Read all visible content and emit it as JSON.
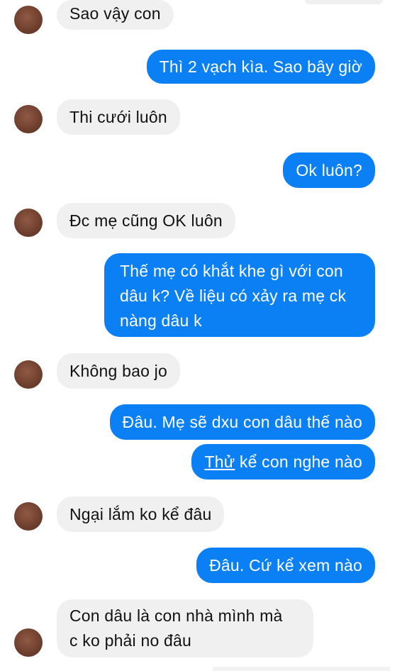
{
  "messages": [
    {
      "side": "in",
      "text": "Sao vậy con"
    },
    {
      "side": "out",
      "text": "Thì 2 vạch kìa. Sao bây giờ"
    },
    {
      "side": "in",
      "text": "Thi cưới luôn"
    },
    {
      "side": "out",
      "text": "Ok luôn?"
    },
    {
      "side": "in",
      "text": "Đc mẹ cũng OK luôn"
    },
    {
      "side": "out",
      "lines": [
        "Thế mẹ có khắt khe gì với con",
        "dâu k? Về liệu có xảy ra mẹ ck",
        "nàng dâu k"
      ]
    },
    {
      "side": "in",
      "text": "Không bao jo"
    },
    {
      "side": "out",
      "text": "Đâu. Mẹ sẽ dxu con dâu thế nào"
    },
    {
      "side": "out",
      "underlined": "Thử",
      "rest": " kể con nghe nào"
    },
    {
      "side": "in",
      "text": "Ngại lắm ko kể đâu"
    },
    {
      "side": "out",
      "text": "Đâu. Cứ kể xem nào"
    },
    {
      "side": "in",
      "lines": [
        "Con dâu là con nhà mình mà",
        "c ko phải no đâu"
      ]
    }
  ],
  "colors": {
    "outgoing_bubble": "#0b80f5",
    "incoming_bubble": "#f1f0f0",
    "avatar": "#6e3e2d"
  }
}
